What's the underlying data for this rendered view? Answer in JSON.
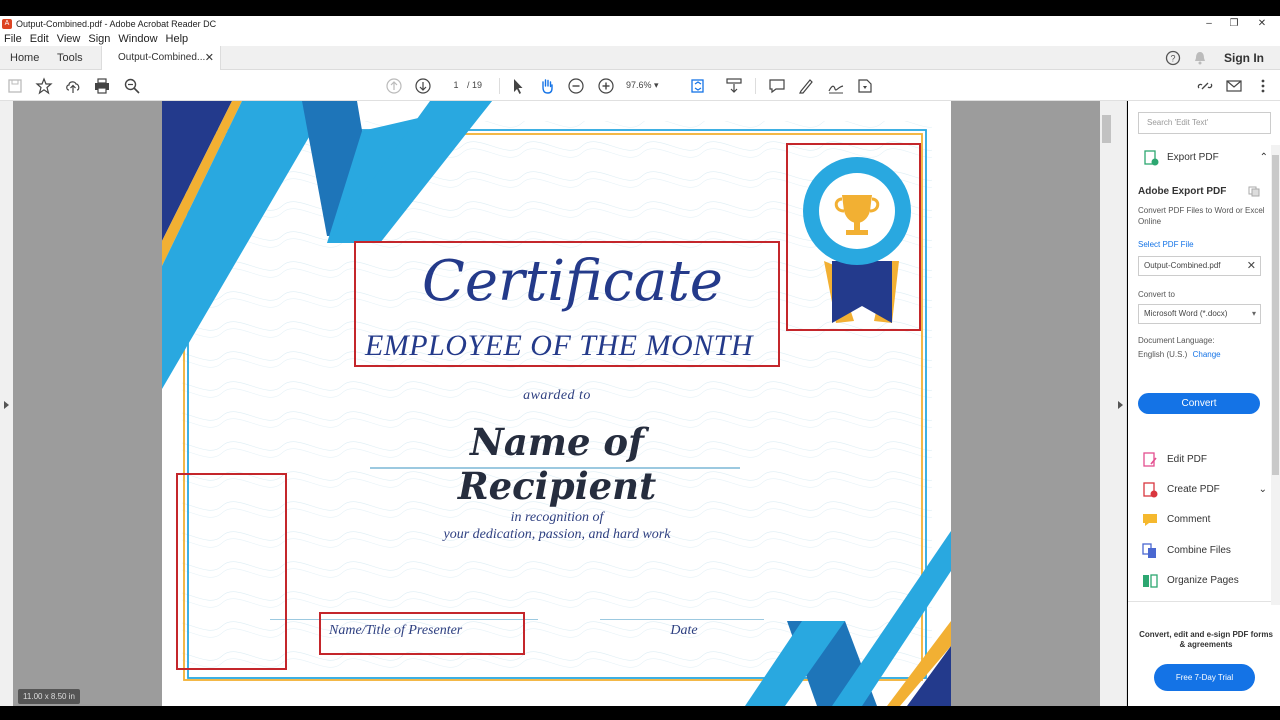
{
  "window": {
    "title": "Output-Combined.pdf - Adobe Acrobat Reader DC",
    "min_icon": "minimize-icon",
    "max_icon": "restore-icon",
    "close_icon": "close-icon"
  },
  "menu": [
    "File",
    "Edit",
    "View",
    "Sign",
    "Window",
    "Help"
  ],
  "tabs": {
    "home": "Home",
    "tools": "Tools",
    "document": "Output-Combined...",
    "sign_in": "Sign In"
  },
  "toolbar": {
    "page_current": "1",
    "page_total": "/ 19",
    "zoom": "97.6%"
  },
  "certificate": {
    "title": "Certificate",
    "subtitle": "EMPLOYEE OF THE MONTH",
    "awarded_to": "awarded to",
    "recipient": "Name of Recipient",
    "recognition_line1": "in recognition of",
    "recognition_line2": "your dedication, passion, and hard work",
    "presenter": "Name/Title of Presenter",
    "date": "Date"
  },
  "page_size": "11.00 x 8.50 in",
  "right_panel": {
    "search_placeholder": "Search 'Edit Text'",
    "export_header": "Export PDF",
    "export_title": "Adobe Export PDF",
    "export_desc": "Convert PDF Files to Word or Excel Online",
    "select_pdf": "Select PDF File",
    "selected_file": "Output-Combined.pdf",
    "convert_to_label": "Convert to",
    "convert_to_value": "Microsoft Word (*.docx)",
    "doc_lang_label": "Document Language:",
    "doc_lang_value": "English (U.S.)",
    "change": "Change",
    "convert_btn": "Convert",
    "tools": [
      "Edit PDF",
      "Create PDF",
      "Comment",
      "Combine Files",
      "Organize Pages"
    ],
    "promo_text": "Convert, edit and e-sign PDF forms & agreements",
    "promo_btn": "Free 7-Day Trial"
  },
  "colors": {
    "brand_blue": "#1473e6",
    "cert_navy": "#243a8a",
    "ribbon_light": "#29a8e0",
    "ribbon_dark": "#1e75b9",
    "accent_gold": "#f2b033",
    "annotation_red": "#c4262b"
  }
}
